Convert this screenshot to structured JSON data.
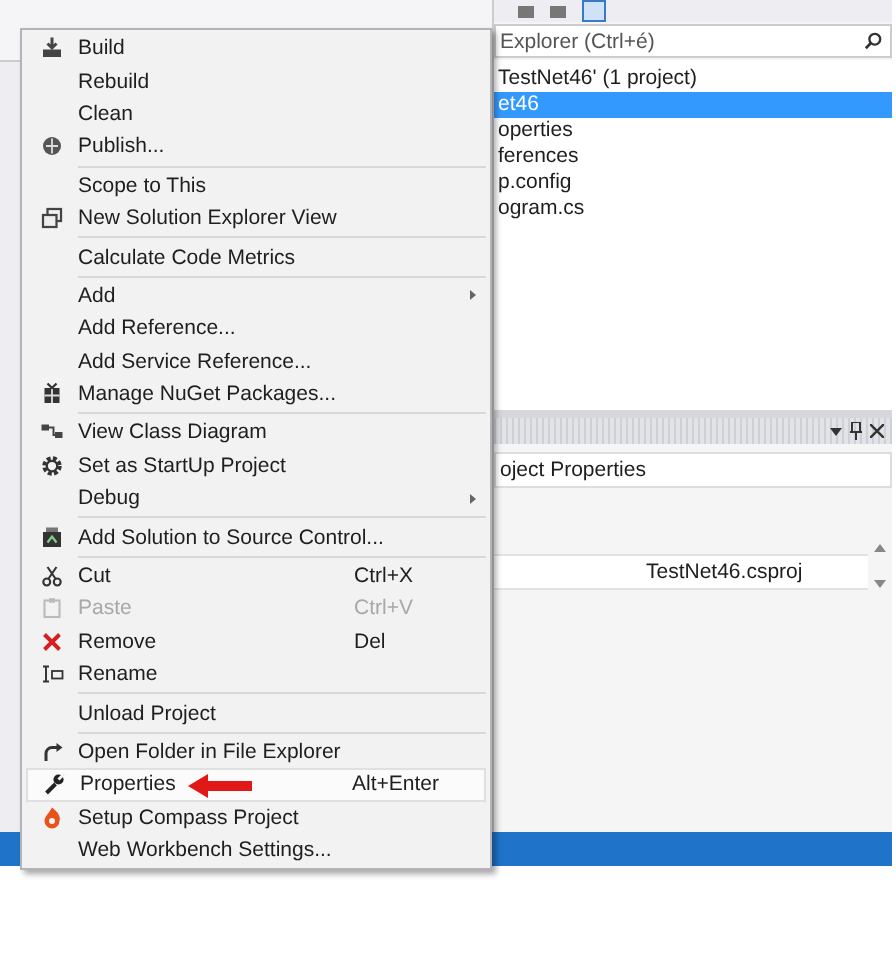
{
  "solution_explorer": {
    "search": {
      "placeholder": "Explorer (Ctrl+é)"
    },
    "tree": [
      {
        "label": "TestNet46' (1 project)",
        "selected": false,
        "children": [
          {
            "label": "et46",
            "selected": true,
            "children": [
              {
                "label": "operties",
                "selected": false
              },
              {
                "label": "ferences",
                "selected": false
              },
              {
                "label": "p.config",
                "selected": false
              },
              {
                "label": "ogram.cs",
                "selected": false
              }
            ]
          }
        ]
      }
    ]
  },
  "properties_panel": {
    "object": "oject Properties",
    "value": "TestNet46.csproj"
  },
  "context_menu": {
    "items": [
      {
        "kind": "item",
        "label": "Build",
        "submenu": false,
        "disabled": false,
        "selected": false
      },
      {
        "kind": "item",
        "label": "Rebuild",
        "submenu": false,
        "disabled": false,
        "selected": false
      },
      {
        "kind": "item",
        "label": "Clean",
        "submenu": false,
        "disabled": false,
        "selected": false
      },
      {
        "kind": "item",
        "label": "Publish...",
        "submenu": false,
        "disabled": false,
        "selected": false
      },
      {
        "kind": "separator"
      },
      {
        "kind": "item",
        "label": "Scope to This",
        "submenu": false,
        "disabled": false,
        "selected": false
      },
      {
        "kind": "item",
        "label": "New Solution Explorer View",
        "submenu": false,
        "disabled": false,
        "selected": false
      },
      {
        "kind": "separator"
      },
      {
        "kind": "item",
        "label": "Calculate Code Metrics",
        "submenu": false,
        "disabled": false,
        "selected": false
      },
      {
        "kind": "separator"
      },
      {
        "kind": "item",
        "label": "Add",
        "submenu": true,
        "disabled": false,
        "selected": false
      },
      {
        "kind": "item",
        "label": "Add Reference...",
        "submenu": false,
        "disabled": false,
        "selected": false
      },
      {
        "kind": "item",
        "label": "Add Service Reference...",
        "submenu": false,
        "disabled": false,
        "selected": false
      },
      {
        "kind": "item",
        "label": "Manage NuGet Packages...",
        "submenu": false,
        "disabled": false,
        "selected": false
      },
      {
        "kind": "separator"
      },
      {
        "kind": "item",
        "label": "View Class Diagram",
        "submenu": false,
        "disabled": false,
        "selected": false
      },
      {
        "kind": "item",
        "label": "Set as StartUp Project",
        "submenu": false,
        "disabled": false,
        "selected": false
      },
      {
        "kind": "item",
        "label": "Debug",
        "submenu": true,
        "disabled": false,
        "selected": false
      },
      {
        "kind": "separator"
      },
      {
        "kind": "item",
        "label": "Add Solution to Source Control...",
        "submenu": false,
        "disabled": false,
        "selected": false
      },
      {
        "kind": "separator"
      },
      {
        "kind": "item",
        "label": "Cut",
        "shortcut": "Ctrl+X",
        "submenu": false,
        "disabled": false,
        "selected": false
      },
      {
        "kind": "item",
        "label": "Paste",
        "shortcut": "Ctrl+V",
        "submenu": false,
        "disabled": true,
        "selected": false
      },
      {
        "kind": "item",
        "label": "Remove",
        "shortcut": "Del",
        "submenu": false,
        "disabled": false,
        "selected": false
      },
      {
        "kind": "item",
        "label": "Rename",
        "submenu": false,
        "disabled": false,
        "selected": false
      },
      {
        "kind": "separator"
      },
      {
        "kind": "item",
        "label": "Unload Project",
        "submenu": false,
        "disabled": false,
        "selected": false
      },
      {
        "kind": "separator"
      },
      {
        "kind": "item",
        "label": "Open Folder in File Explorer",
        "submenu": false,
        "disabled": false,
        "selected": false
      },
      {
        "kind": "item",
        "label": "Properties",
        "shortcut": "Alt+Enter",
        "submenu": false,
        "disabled": false,
        "selected": true
      },
      {
        "kind": "item",
        "label": "Setup Compass Project",
        "submenu": false,
        "disabled": false,
        "selected": false
      },
      {
        "kind": "item",
        "label": "Web Workbench Settings...",
        "submenu": false,
        "disabled": false,
        "selected": false
      }
    ]
  }
}
